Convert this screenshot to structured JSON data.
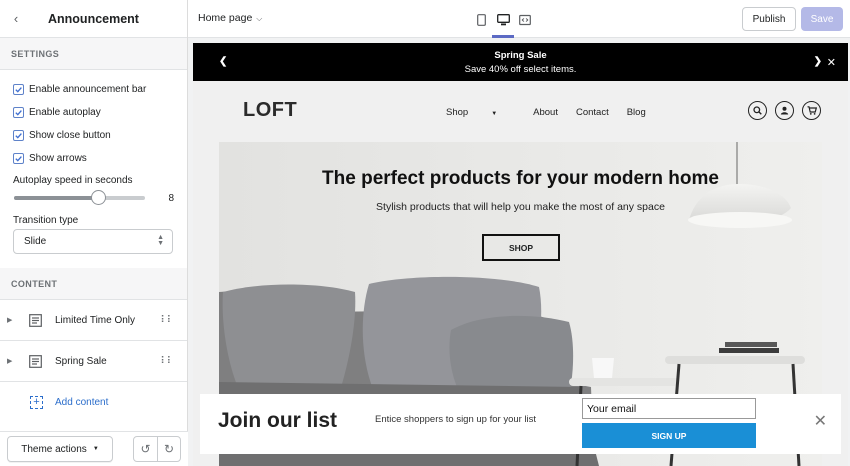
{
  "sidebar": {
    "title": "Announcement",
    "settings_header": "SETTINGS",
    "checkboxes": [
      {
        "label": "Enable announcement bar",
        "checked": true
      },
      {
        "label": "Enable autoplay",
        "checked": true
      },
      {
        "label": "Show close button",
        "checked": true
      },
      {
        "label": "Show arrows",
        "checked": true
      }
    ],
    "autoplay": {
      "label": "Autoplay speed in seconds",
      "value": "8",
      "fraction": 0.64
    },
    "transition": {
      "label": "Transition type",
      "value": "Slide"
    },
    "content_header": "CONTENT",
    "blocks": [
      {
        "label": "Limited Time Only"
      },
      {
        "label": "Spring Sale"
      }
    ],
    "add_content": "Add content",
    "footer": {
      "theme_actions": "Theme actions"
    }
  },
  "topbar": {
    "page": "Home page",
    "publish": "Publish",
    "save": "Save",
    "devices": [
      "mobile-icon",
      "desktop-icon",
      "fullscreen-icon"
    ],
    "active_device": "desktop-icon"
  },
  "preview": {
    "announcement": {
      "title": "Spring Sale",
      "subtitle": "Save 40% off select items."
    },
    "logo": "LOFT",
    "nav": [
      "Shop",
      "About",
      "Contact",
      "Blog"
    ],
    "hero": {
      "title": "The perfect products for your modern home",
      "subtitle": "Stylish products that will help you make the most of any space",
      "button": "SHOP"
    },
    "signup": {
      "title": "Join our list",
      "text": "Entice shoppers to sign up for your list",
      "email_value": "Your email",
      "button": "SIGN UP"
    }
  },
  "colors": {
    "accent": "#5c6ac4",
    "save_disabled": "#b4b9e7",
    "signup_button": "#1a8fd6",
    "link": "#2c6ecb"
  }
}
